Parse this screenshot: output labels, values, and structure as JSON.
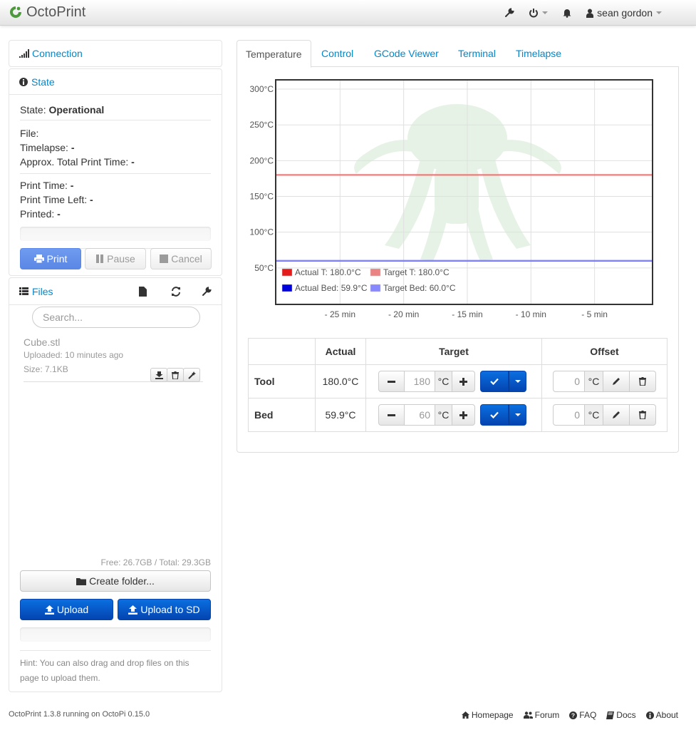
{
  "navbar": {
    "brand": "OctoPrint",
    "user": "sean gordon"
  },
  "connection": {
    "title": "Connection"
  },
  "state": {
    "title": "State",
    "state_label": "State:",
    "state_value": "Operational",
    "file_label": "File:",
    "timelapse_label": "Timelapse:",
    "timelapse_value": "-",
    "approx_label": "Approx. Total Print Time:",
    "approx_value": "-",
    "print_time_label": "Print Time:",
    "print_time_value": "-",
    "print_time_left_label": "Print Time Left:",
    "print_time_left_value": "-",
    "printed_label": "Printed:",
    "printed_value": "-",
    "print_button": "Print",
    "pause_button": "Pause",
    "cancel_button": "Cancel"
  },
  "files": {
    "title": "Files",
    "search_placeholder": "Search...",
    "items": [
      {
        "name": "Cube.stl",
        "uploaded": "Uploaded: 10 minutes ago",
        "size": "Size: 7.1KB"
      }
    ],
    "usage": "Free: 26.7GB / Total: 29.3GB",
    "create_folder": "Create folder...",
    "upload": "Upload",
    "upload_sd": "Upload to SD",
    "hint": "Hint: You can also drag and drop files on this page to upload them."
  },
  "tabs": [
    "Temperature",
    "Control",
    "GCode Viewer",
    "Terminal",
    "Timelapse"
  ],
  "chart_data": {
    "type": "line",
    "x_tick_labels": [
      "- 25 min",
      "- 20 min",
      "- 15 min",
      "- 10 min",
      "- 5 min"
    ],
    "y_tick_labels": [
      "300°C",
      "250°C",
      "200°C",
      "150°C",
      "100°C",
      "50°C"
    ],
    "x_ticks_min": [
      -25,
      -20,
      -15,
      -10,
      -5
    ],
    "y_ticks": [
      300,
      250,
      200,
      150,
      100,
      50
    ],
    "xlim": [
      -30,
      -0.5
    ],
    "ylim": [
      0,
      312
    ],
    "grid": true,
    "legend_position": "bottom-left",
    "series": [
      {
        "name": "Actual T: 180.0°C",
        "color": "#e41b1b",
        "values": [
          180,
          180
        ]
      },
      {
        "name": "Target T: 180.0°C",
        "color": "#ec8383",
        "values": [
          180,
          180
        ]
      },
      {
        "name": "Actual Bed: 59.9°C",
        "color": "#0000dd",
        "values": [
          59.9,
          59.9
        ]
      },
      {
        "name": "Target Bed: 60.0°C",
        "color": "#8888ff",
        "values": [
          60,
          60
        ]
      }
    ],
    "x": [
      -30,
      -0.5
    ]
  },
  "temp_table": {
    "headers": [
      "",
      "Actual",
      "Target",
      "Offset"
    ],
    "rows": [
      {
        "name": "Tool",
        "actual": "180.0°C",
        "target": "180",
        "unit": "°C",
        "offset": "0"
      },
      {
        "name": "Bed",
        "actual": "59.9°C",
        "target": "60",
        "unit": "°C",
        "offset": "0"
      }
    ]
  },
  "footer": {
    "version": "OctoPrint 1.3.8 running on OctoPi 0.15.0",
    "links": [
      "Homepage",
      "Forum",
      "FAQ",
      "Docs",
      "About"
    ]
  }
}
